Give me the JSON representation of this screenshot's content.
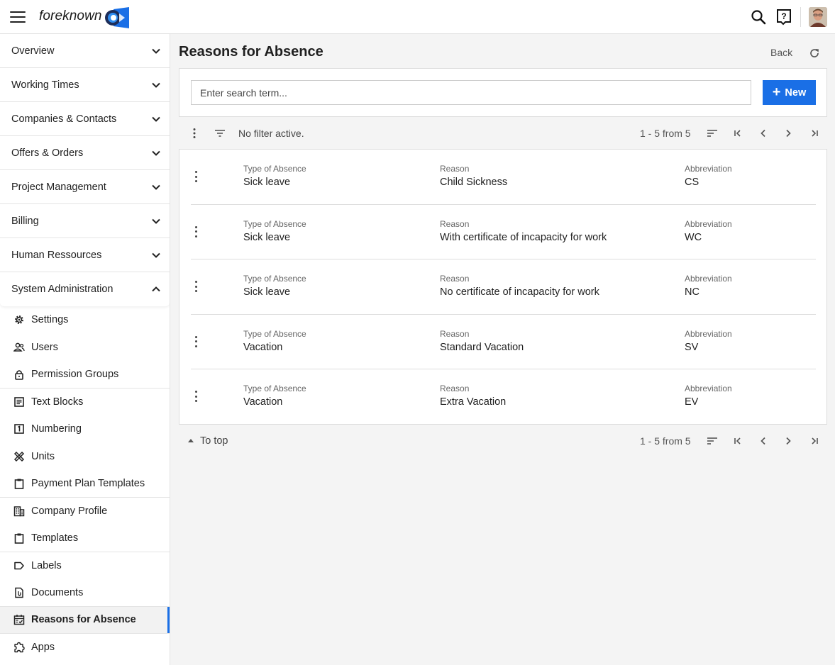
{
  "app": {
    "logo_text": "foreknown",
    "brand_color": "#1a6fe6",
    "icons": {
      "menu": "hamburger-icon",
      "search": "search-icon",
      "help": "help-icon",
      "avatar": "avatar"
    }
  },
  "sidebar": {
    "sections": [
      {
        "label": "Overview",
        "expanded": false
      },
      {
        "label": "Working Times",
        "expanded": false
      },
      {
        "label": "Companies & Contacts",
        "expanded": false
      },
      {
        "label": "Offers & Orders",
        "expanded": false
      },
      {
        "label": "Project Management",
        "expanded": false
      },
      {
        "label": "Billing",
        "expanded": false
      },
      {
        "label": "Human Ressources",
        "expanded": false
      },
      {
        "label": "System Administration",
        "expanded": true
      }
    ],
    "admin_items": [
      {
        "label": "Settings",
        "icon": "gear-icon"
      },
      {
        "label": "Users",
        "icon": "users-icon"
      },
      {
        "label": "Permission Groups",
        "icon": "lock-icon"
      },
      {
        "label": "Text Blocks",
        "icon": "text-block-icon"
      },
      {
        "label": "Numbering",
        "icon": "numbering-icon"
      },
      {
        "label": "Units",
        "icon": "units-icon"
      },
      {
        "label": "Payment Plan Templates",
        "icon": "clipboard-icon"
      },
      {
        "label": "Company Profile",
        "icon": "building-icon"
      },
      {
        "label": "Templates",
        "icon": "clipboard-icon"
      },
      {
        "label": "Labels",
        "icon": "label-icon"
      },
      {
        "label": "Documents",
        "icon": "document-icon"
      },
      {
        "label": "Reasons for Absence",
        "icon": "calendar-check-icon",
        "active": true
      },
      {
        "label": "Apps",
        "icon": "puzzle-icon"
      }
    ]
  },
  "header": {
    "title": "Reasons for Absence",
    "back_label": "Back"
  },
  "search": {
    "placeholder": "Enter search term...",
    "value": "",
    "new_label": "New"
  },
  "toolbar": {
    "filter_text": "No filter active.",
    "pager_text": "1 - 5 from 5"
  },
  "list": {
    "columns": [
      "Type of Absence",
      "Reason",
      "Abbreviation"
    ],
    "rows": [
      {
        "type": "Sick leave",
        "reason": "Child Sickness",
        "abbreviation": "CS"
      },
      {
        "type": "Sick leave",
        "reason": "With certificate of incapacity for work",
        "abbreviation": "WC"
      },
      {
        "type": "Sick leave",
        "reason": "No certificate of incapacity for work",
        "abbreviation": "NC"
      },
      {
        "type": "Vacation",
        "reason": "Standard Vacation",
        "abbreviation": "SV"
      },
      {
        "type": "Vacation",
        "reason": "Extra Vacation",
        "abbreviation": "EV"
      }
    ]
  },
  "footer": {
    "to_top_label": "To top",
    "pager_text": "1 - 5 from 5"
  }
}
